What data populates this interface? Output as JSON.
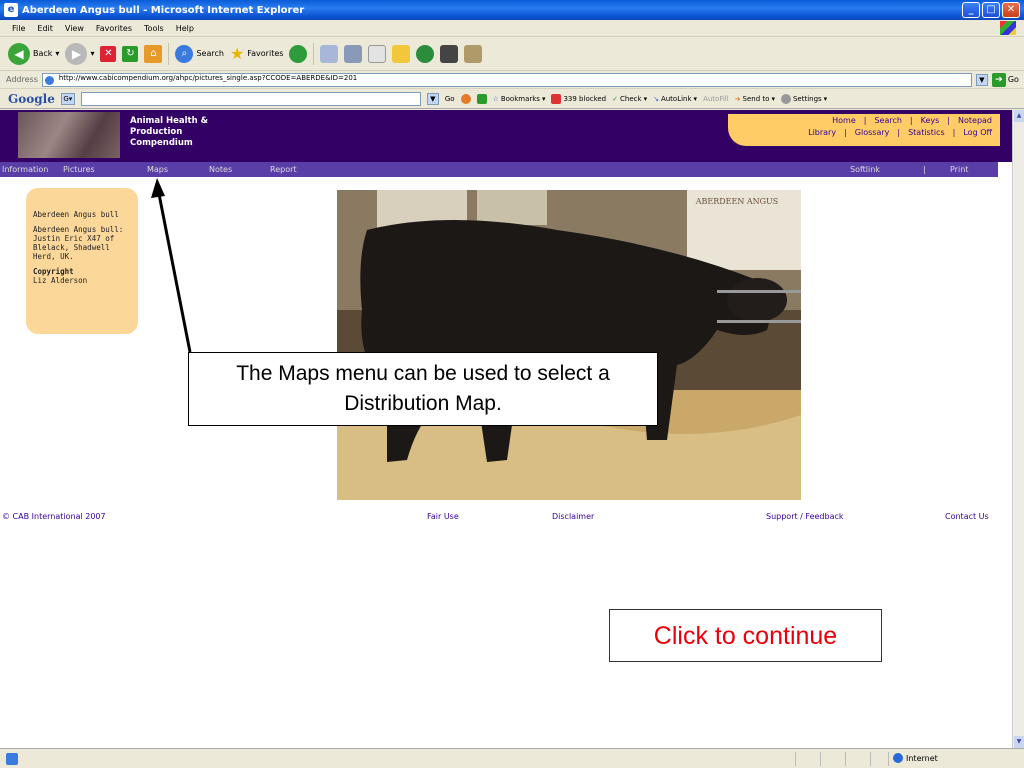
{
  "window": {
    "title": "Aberdeen Angus bull - Microsoft Internet Explorer",
    "controls": [
      "minimize",
      "maximize",
      "close"
    ]
  },
  "menubar": {
    "items": [
      "File",
      "Edit",
      "View",
      "Favorites",
      "Tools",
      "Help"
    ]
  },
  "toolbar": {
    "back_label": "Back",
    "search_label": "Search",
    "favorites_label": "Favorites"
  },
  "address": {
    "label": "Address",
    "url": "http://www.cabicompendium.org/ahpc/pictures_single.asp?CCODE=ABERDE&ID=201",
    "go_label": "Go"
  },
  "google": {
    "logo": "Google",
    "go": "Go",
    "bookmarks": "Bookmarks",
    "blocked": "339 blocked",
    "check": "Check",
    "autolink": "AutoLink",
    "autofill": "AutoFill",
    "sendto": "Send to",
    "settings": "Settings"
  },
  "site": {
    "title_lines": [
      "Animal Health &",
      "Production",
      "Compendium"
    ],
    "topnav_row1": [
      "Home",
      "|",
      "Search",
      "|",
      "Keys",
      "|",
      "Notepad"
    ],
    "topnav_row2": [
      "Library",
      "|",
      "Glossary",
      "|",
      "Statistics",
      "|",
      "Log Off"
    ],
    "nav": {
      "information": "Information",
      "pictures": "Pictures",
      "maps": "Maps",
      "notes": "Notes",
      "report": "Report",
      "softlink": "Softlink",
      "divider": "|",
      "print": "Print"
    },
    "info_panel": {
      "title": "Aberdeen Angus bull",
      "caption": "Aberdeen Angus bull: Justin Eric X47 of Blelack, Shadwell Herd, UK.",
      "copyright_label": "Copyright",
      "copyright_holder": "Liz Alderson"
    },
    "photo_sign": "ABERDEEN ANGUS",
    "footer": {
      "copyright": "© CAB International 2007",
      "fair_use": "Fair Use",
      "disclaimer": "Disclaimer",
      "support": "Support / Feedback",
      "contact": "Contact Us"
    }
  },
  "overlay": {
    "callout_text": "The Maps menu can be used to select a Distribution Map.",
    "continue_text": "Click to continue",
    "continue_color": "#e8000b"
  },
  "status": {
    "zone": "Internet"
  }
}
